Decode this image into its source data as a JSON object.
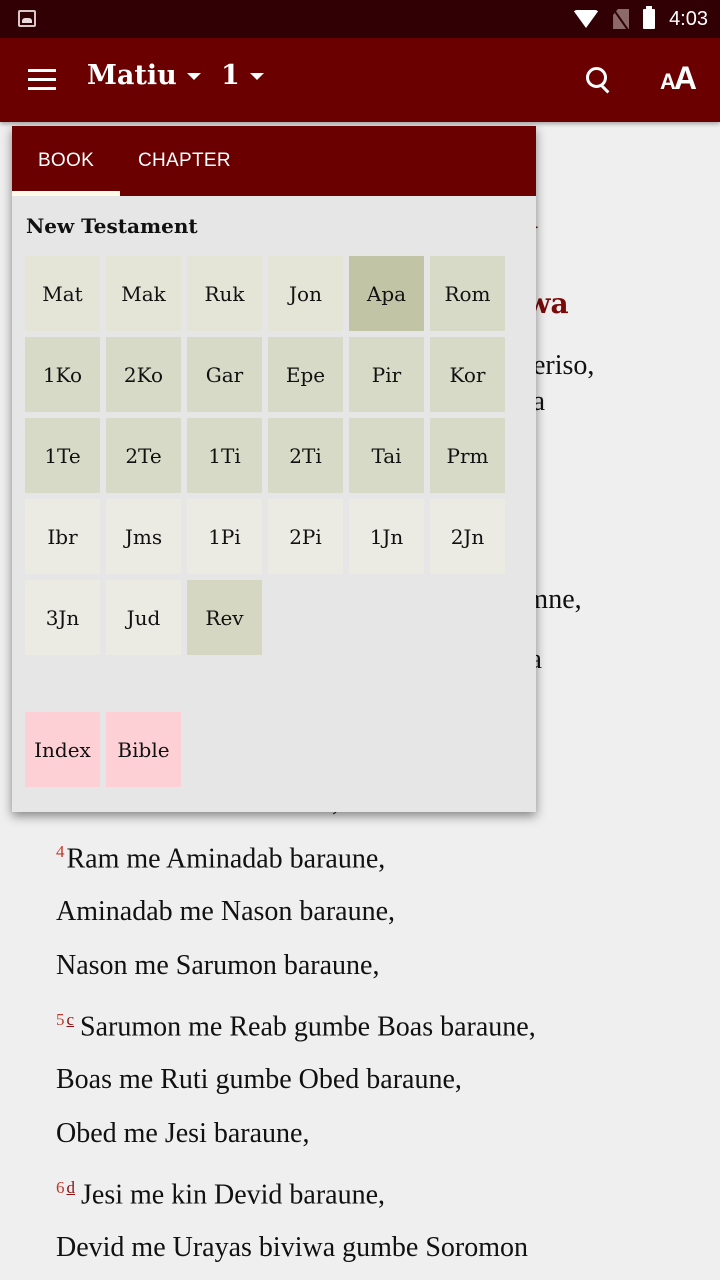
{
  "status_bar": {
    "time": "4:03",
    "icons": [
      "image-notification-icon",
      "wifi-icon",
      "no-sim-icon",
      "battery-icon"
    ]
  },
  "toolbar": {
    "book": "Matiu",
    "chapter": "1",
    "text_size_small": "A",
    "text_size_big": "A"
  },
  "content": {
    "headings": [
      "wa",
      "yawa"
    ],
    "partial_lines": [
      "ı Keriso,",
      "awa",
      "yamne,",
      "eira"
    ],
    "occluded_line": "Esuron me Ram baraune,",
    "verses": [
      {
        "num": "4",
        "footnote": "",
        "text": "Ram me Aminadab baraune,"
      },
      {
        "num": "",
        "footnote": "",
        "text": "Aminadab me Nason baraune,"
      },
      {
        "num": "",
        "footnote": "",
        "text": "Nason me Sarumon baraune,"
      },
      {
        "num": "5",
        "footnote": "c",
        "text": "Sarumon me Reab gumbe Boas baraune,"
      },
      {
        "num": "",
        "footnote": "",
        "text": "Boas me Ruti gumbe Obed baraune,"
      },
      {
        "num": "",
        "footnote": "",
        "text": "Obed me Jesi baraune,"
      },
      {
        "num": "6",
        "footnote": "d",
        "text": "Jesi me kin Devid baraune,"
      },
      {
        "num": "",
        "footnote": "",
        "text": "Devid me Urayas biviwa gumbe Soromon"
      }
    ]
  },
  "popup": {
    "tabs": [
      {
        "label": "BOOK",
        "active": true
      },
      {
        "label": "CHAPTER",
        "active": false
      }
    ],
    "section_title": "New Testament",
    "books": [
      {
        "label": "Mat",
        "group": "gospel"
      },
      {
        "label": "Mak",
        "group": "gospel"
      },
      {
        "label": "Ruk",
        "group": "gospel"
      },
      {
        "label": "Jon",
        "group": "gospel"
      },
      {
        "label": "Apa",
        "group": "acts"
      },
      {
        "label": "Rom",
        "group": "epistle-p"
      },
      {
        "label": "1Ko",
        "group": "epistle-p"
      },
      {
        "label": "2Ko",
        "group": "epistle-p"
      },
      {
        "label": "Gar",
        "group": "epistle-p"
      },
      {
        "label": "Epe",
        "group": "epistle-p"
      },
      {
        "label": "Pir",
        "group": "epistle-p"
      },
      {
        "label": "Kor",
        "group": "epistle-p"
      },
      {
        "label": "1Te",
        "group": "epistle-p"
      },
      {
        "label": "2Te",
        "group": "epistle-p"
      },
      {
        "label": "1Ti",
        "group": "epistle-p"
      },
      {
        "label": "2Ti",
        "group": "epistle-p"
      },
      {
        "label": "Tai",
        "group": "epistle-p"
      },
      {
        "label": "Prm",
        "group": "epistle-p"
      },
      {
        "label": "Ibr",
        "group": "epistle-g"
      },
      {
        "label": "Jms",
        "group": "epistle-g"
      },
      {
        "label": "1Pi",
        "group": "epistle-g"
      },
      {
        "label": "2Pi",
        "group": "epistle-g"
      },
      {
        "label": "1Jn",
        "group": "epistle-g"
      },
      {
        "label": "2Jn",
        "group": "epistle-g"
      },
      {
        "label": "3Jn",
        "group": "epistle-g"
      },
      {
        "label": "Jud",
        "group": "epistle-g"
      },
      {
        "label": "Rev",
        "group": "rev"
      }
    ],
    "buttons": [
      "Index",
      "Bible"
    ]
  },
  "colors": {
    "status_bar": "#300005",
    "toolbar": "#6b0000",
    "heading": "#7a0a0a",
    "verse_number": "#c0392b",
    "gospel_tile": "#e4e5d6",
    "acts_tile": "#c2c4a6",
    "pauline_tile": "#d8dac8",
    "general_epistle_tile": "#ebebe3",
    "revelation_tile": "#d5d7c2",
    "nav_button": "#fdd0d6"
  }
}
